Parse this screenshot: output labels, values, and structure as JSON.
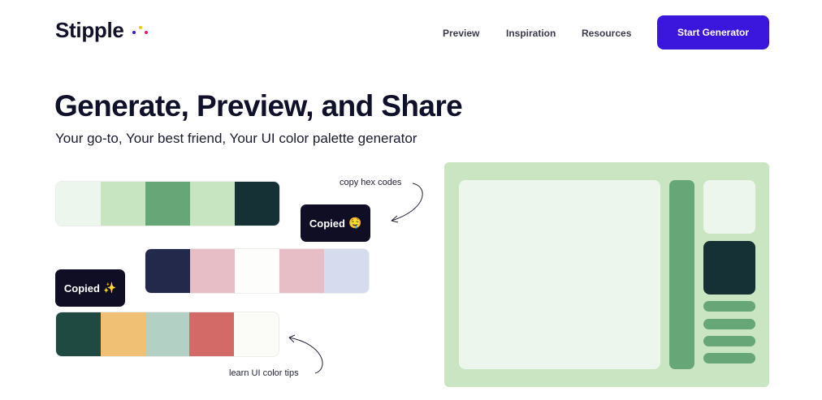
{
  "header": {
    "logo_text": "Stipple",
    "logo_dot_colors": [
      "#3b16dd",
      "#f5c400",
      "#e5186b"
    ],
    "nav": [
      {
        "label": "Preview"
      },
      {
        "label": "Inspiration"
      },
      {
        "label": "Resources"
      }
    ],
    "cta_label": "Start Generator",
    "cta_color": "#3b16dd"
  },
  "hero": {
    "title": "Generate, Preview, and Share",
    "subtitle": "Your go-to, Your best friend, Your UI color palette generator"
  },
  "palettes": [
    {
      "colors": [
        "#edf6ec",
        "#c8e5c1",
        "#67a676",
        "#c8e5c1",
        "#153135"
      ]
    },
    {
      "colors": [
        "#22294a",
        "#e7bec5",
        "#fdfdfb",
        "#e7bec5",
        "#d6dbed"
      ]
    },
    {
      "colors": [
        "#1f4a42",
        "#f0c074",
        "#b3d0c5",
        "#d46a68",
        "#fbfbf8"
      ]
    }
  ],
  "chips": [
    {
      "label": "Copied",
      "emoji": "🤤"
    },
    {
      "label": "Copied",
      "emoji": "✨"
    }
  ],
  "annotations": {
    "copy_hex": "copy hex codes",
    "learn_tips": "learn UI color tips"
  },
  "preview_mock": {
    "background": "#c9e5c2",
    "panel": "#edf6ec",
    "accent": "#67a676",
    "dark": "#153135"
  }
}
